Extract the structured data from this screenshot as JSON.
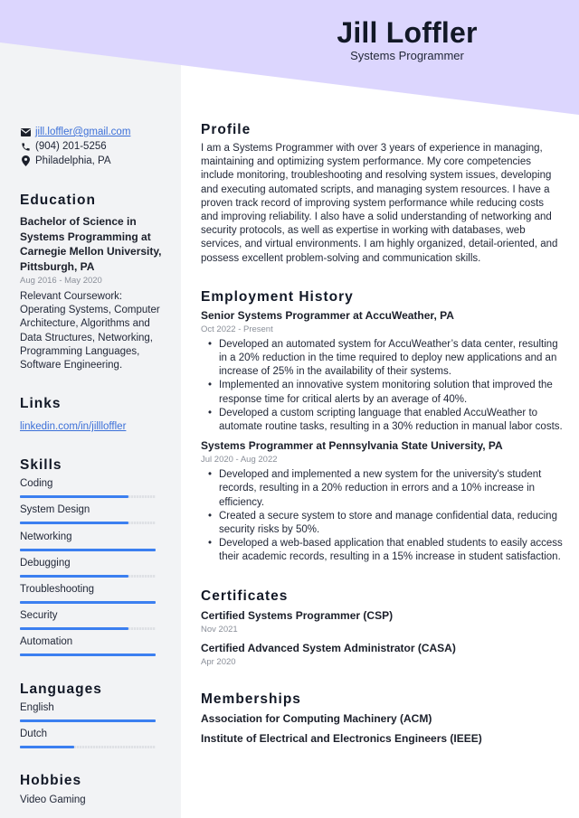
{
  "header": {
    "name": "Jill Loffler",
    "title": "Systems Programmer",
    "accent_color": "#dcd6fe"
  },
  "contact": {
    "email": "jill.loffler@gmail.com",
    "phone": "(904) 201-5256",
    "location": "Philadelphia, PA",
    "icons": [
      "envelope-icon",
      "phone-icon",
      "map-pin-icon"
    ]
  },
  "education": {
    "heading": "Education",
    "degree": "Bachelor of Science in Systems Programming at Carnegie Mellon University, Pittsburgh, PA",
    "dates": "Aug 2016 - May 2020",
    "description": "Relevant Coursework: Operating Systems, Computer Architecture, Algorithms and Data Structures, Networking, Programming Languages, Software Engineering."
  },
  "links": {
    "heading": "Links",
    "items": [
      {
        "label": "linkedin.com/in/jillloffler"
      }
    ]
  },
  "skills": {
    "heading": "Skills",
    "bar_color": "#3b7ff0",
    "items": [
      {
        "label": "Coding",
        "level": 80
      },
      {
        "label": "System Design",
        "level": 80
      },
      {
        "label": "Networking",
        "level": 100
      },
      {
        "label": "Debugging",
        "level": 80
      },
      {
        "label": "Troubleshooting",
        "level": 100
      },
      {
        "label": "Security",
        "level": 80
      },
      {
        "label": "Automation",
        "level": 100
      }
    ]
  },
  "languages": {
    "heading": "Languages",
    "items": [
      {
        "label": "English",
        "level": 100
      },
      {
        "label": "Dutch",
        "level": 40
      }
    ]
  },
  "hobbies": {
    "heading": "Hobbies",
    "items": [
      "Video Gaming"
    ]
  },
  "profile": {
    "heading": "Profile",
    "text": "I am a Systems Programmer with over 3 years of experience in managing, maintaining and optimizing system performance. My core competencies include monitoring, troubleshooting and resolving system issues, developing and executing automated scripts, and managing system resources. I have a proven track record of improving system performance while reducing costs and improving reliability. I also have a solid understanding of networking and security protocols, as well as expertise in working with databases, web services, and virtual environments. I am highly organized, detail-oriented, and possess excellent problem-solving and communication skills."
  },
  "employment": {
    "heading": "Employment History",
    "jobs": [
      {
        "title": "Senior Systems Programmer at AccuWeather, PA",
        "dates": "Oct 2022 - Present",
        "bullets": [
          "Developed an automated system for AccuWeather’s data center, resulting in a 20% reduction in the time required to deploy new applications and an increase of 25% in the availability of their systems.",
          "Implemented an innovative system monitoring solution that improved the response time for critical alerts by an average of 40%.",
          "Developed a custom scripting language that enabled AccuWeather to automate routine tasks, resulting in a 30% reduction in manual labor costs."
        ]
      },
      {
        "title": "Systems Programmer at Pennsylvania State University, PA",
        "dates": "Jul 2020 - Aug 2022",
        "bullets": [
          "Developed and implemented a new system for the university's student records, resulting in a 20% reduction in errors and a 10% increase in efficiency.",
          "Created a secure system to store and manage confidential data, reducing security risks by 50%.",
          "Developed a web-based application that enabled students to easily access their academic records, resulting in a 15% increase in student satisfaction."
        ]
      }
    ]
  },
  "certificates": {
    "heading": "Certificates",
    "items": [
      {
        "name": "Certified Systems Programmer (CSP)",
        "date": "Nov 2021"
      },
      {
        "name": "Certified Advanced System Administrator (CASA)",
        "date": "Apr 2020"
      }
    ]
  },
  "memberships": {
    "heading": "Memberships",
    "items": [
      "Association for Computing Machinery (ACM)",
      "Institute of Electrical and Electronics Engineers (IEEE)"
    ]
  }
}
